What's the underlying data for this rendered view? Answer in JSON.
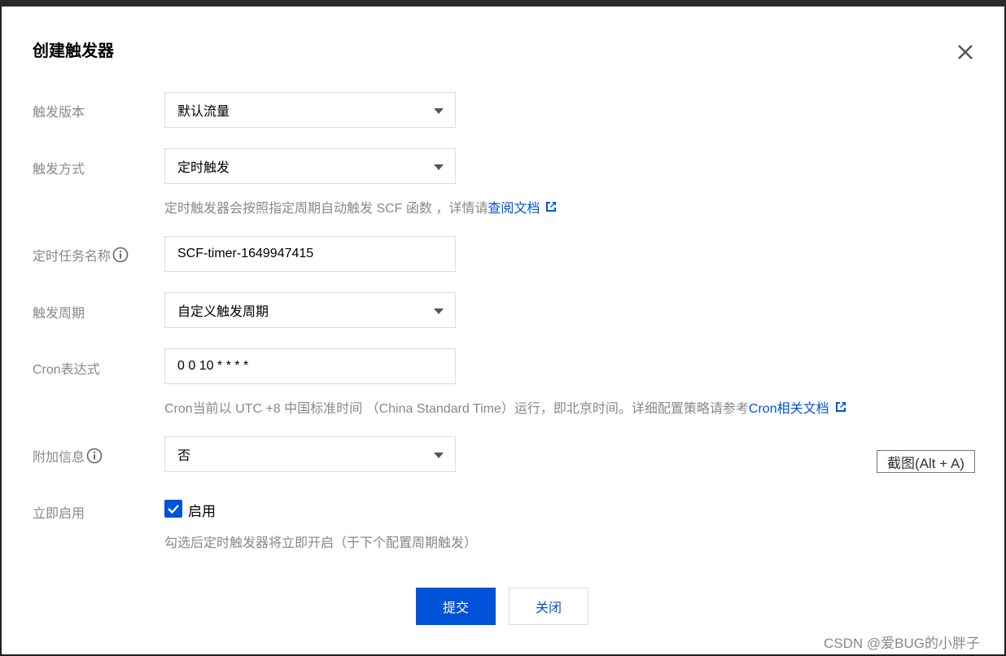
{
  "dialog": {
    "title": "创建触发器",
    "close_icon": "close-icon"
  },
  "form": {
    "version": {
      "label": "触发版本",
      "value": "默认流量"
    },
    "method": {
      "label": "触发方式",
      "value": "定时触发",
      "hint_text": "定时触发器会按照指定周期自动触发 SCF 函数 ，详情请",
      "hint_link": "查阅文档"
    },
    "task_name": {
      "label": "定时任务名称",
      "value": "SCF-timer-1649947415",
      "icon": "info-icon"
    },
    "period": {
      "label": "触发周期",
      "value": "自定义触发周期"
    },
    "cron": {
      "label": "Cron表达式",
      "value": "0 0 10 * * * *",
      "hint_text": "Cron当前以 UTC +8 中国标准时间 （China Standard Time）运行，即北京时间。详细配置策略请参考",
      "hint_link": "Cron相关文档"
    },
    "extra_info": {
      "label": "附加信息",
      "value": "否",
      "icon": "info-icon"
    },
    "enable": {
      "label": "立即启用",
      "checkbox_label": "启用",
      "checked": true,
      "hint_text": "勾选后定时触发器将立即开启（于下个配置周期触发）"
    }
  },
  "buttons": {
    "submit": "提交",
    "close": "关闭"
  },
  "tooltip": "截图(Alt + A)",
  "watermark": "CSDN @爱BUG的小胖子",
  "colors": {
    "primary": "#0052d9",
    "label": "#888888",
    "border": "#dcdcdc"
  }
}
